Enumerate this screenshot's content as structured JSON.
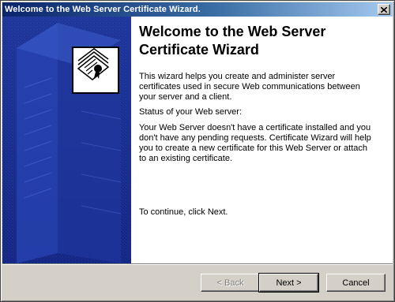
{
  "window": {
    "title": "Welcome to the Web Server Certificate Wizard.",
    "close_icon": "close-icon"
  },
  "banner": {
    "icon": "certificate-wizard-icon",
    "background_color": "#1a2d8f"
  },
  "content": {
    "heading": "Welcome to the Web Server Certificate Wizard",
    "intro": "This wizard helps you create and administer server certificates used in secure Web communications between your server and a client.",
    "status_label": "Status of your Web server:",
    "status_text": "Your Web Server doesn't have a certificate installed and you don't have any pending requests. Certificate Wizard will help you to create a new certificate for this Web Server or attach to an existing certificate.",
    "continue_text": "To continue, click Next."
  },
  "buttons": {
    "back": "< Back",
    "next": "Next >",
    "cancel": "Cancel"
  },
  "colors": {
    "titlebar_start": "#0a246a",
    "titlebar_end": "#a6caf0",
    "dialog_face": "#d4d0c8"
  }
}
